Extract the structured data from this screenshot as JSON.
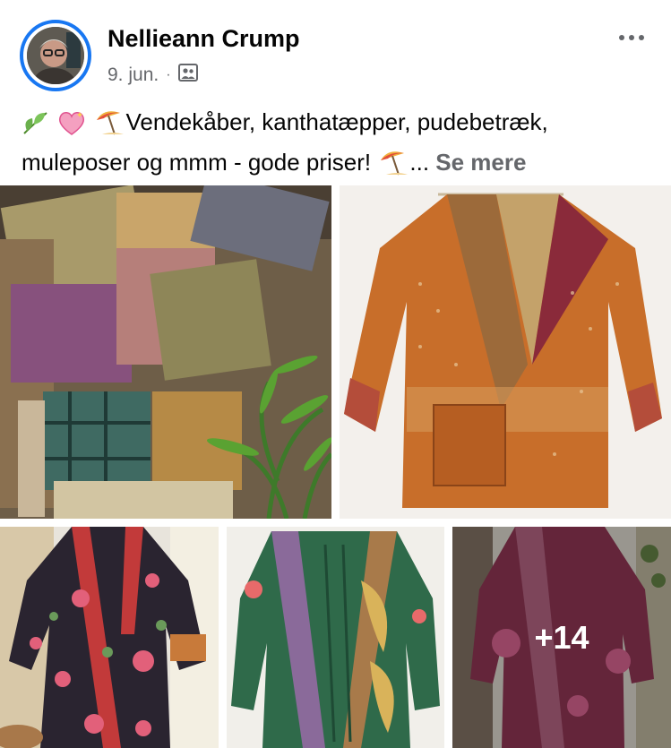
{
  "post": {
    "author": "Nellieann Crump",
    "date": "9. jun.",
    "separator": "·",
    "text": "Vendekåber, kanthatæpper, pudebetræk, muleposer og mmm - gode priser!",
    "ellipsis": "...",
    "see_more": "Se mere"
  },
  "gallery": {
    "more_count": "+14"
  },
  "icons": {
    "more": "more-horizontal-icon",
    "privacy": "friends-audience-icon",
    "emoji_1": "herb-emoji",
    "emoji_2": "sparkling-heart-emoji",
    "emoji_3": "beach-umbrella-emoji"
  },
  "colors": {
    "accent": "#1877f2",
    "secondary_text": "#65676b",
    "primary_text": "#050505"
  }
}
